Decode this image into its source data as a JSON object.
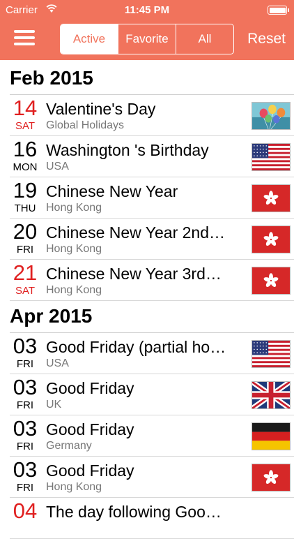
{
  "status_bar": {
    "carrier": "Carrier",
    "time": "11:45 PM"
  },
  "header": {
    "segments": [
      "Active",
      "Favorite",
      "All"
    ],
    "selected_segment": "Active",
    "reset_label": "Reset",
    "accent_color": "#f1735c"
  },
  "sections": [
    {
      "label": "Feb 2015",
      "items": [
        {
          "day": "14",
          "weekday": "SAT",
          "title": "Valentine's Day",
          "subtitle": "Global Holidays",
          "icon": "balloons-icon",
          "red": true
        },
        {
          "day": "16",
          "weekday": "MON",
          "title": "Washington 's Birthday",
          "subtitle": "USA",
          "icon": "usa-flag-icon",
          "red": false
        },
        {
          "day": "19",
          "weekday": "THU",
          "title": "Chinese New Year",
          "subtitle": "Hong Kong",
          "icon": "hong-kong-flag-icon",
          "red": false
        },
        {
          "day": "20",
          "weekday": "FRI",
          "title": "Chinese New Year 2nd…",
          "subtitle": "Hong Kong",
          "icon": "hong-kong-flag-icon",
          "red": false
        },
        {
          "day": "21",
          "weekday": "SAT",
          "title": "Chinese New Year 3rd…",
          "subtitle": "Hong Kong",
          "icon": "hong-kong-flag-icon",
          "red": true
        }
      ]
    },
    {
      "label": "Apr 2015",
      "items": [
        {
          "day": "03",
          "weekday": "FRI",
          "title": "Good Friday (partial ho…",
          "subtitle": "USA",
          "icon": "usa-flag-icon",
          "red": false
        },
        {
          "day": "03",
          "weekday": "FRI",
          "title": "Good Friday",
          "subtitle": "UK",
          "icon": "uk-flag-icon",
          "red": false
        },
        {
          "day": "03",
          "weekday": "FRI",
          "title": "Good Friday",
          "subtitle": "Germany",
          "icon": "germany-flag-icon",
          "red": false
        },
        {
          "day": "03",
          "weekday": "FRI",
          "title": "Good Friday",
          "subtitle": "Hong Kong",
          "icon": "hong-kong-flag-icon",
          "red": false
        },
        {
          "day": "04",
          "weekday": "",
          "title": "The day following Goo…",
          "subtitle": "",
          "icon": "",
          "red": true
        }
      ]
    }
  ]
}
